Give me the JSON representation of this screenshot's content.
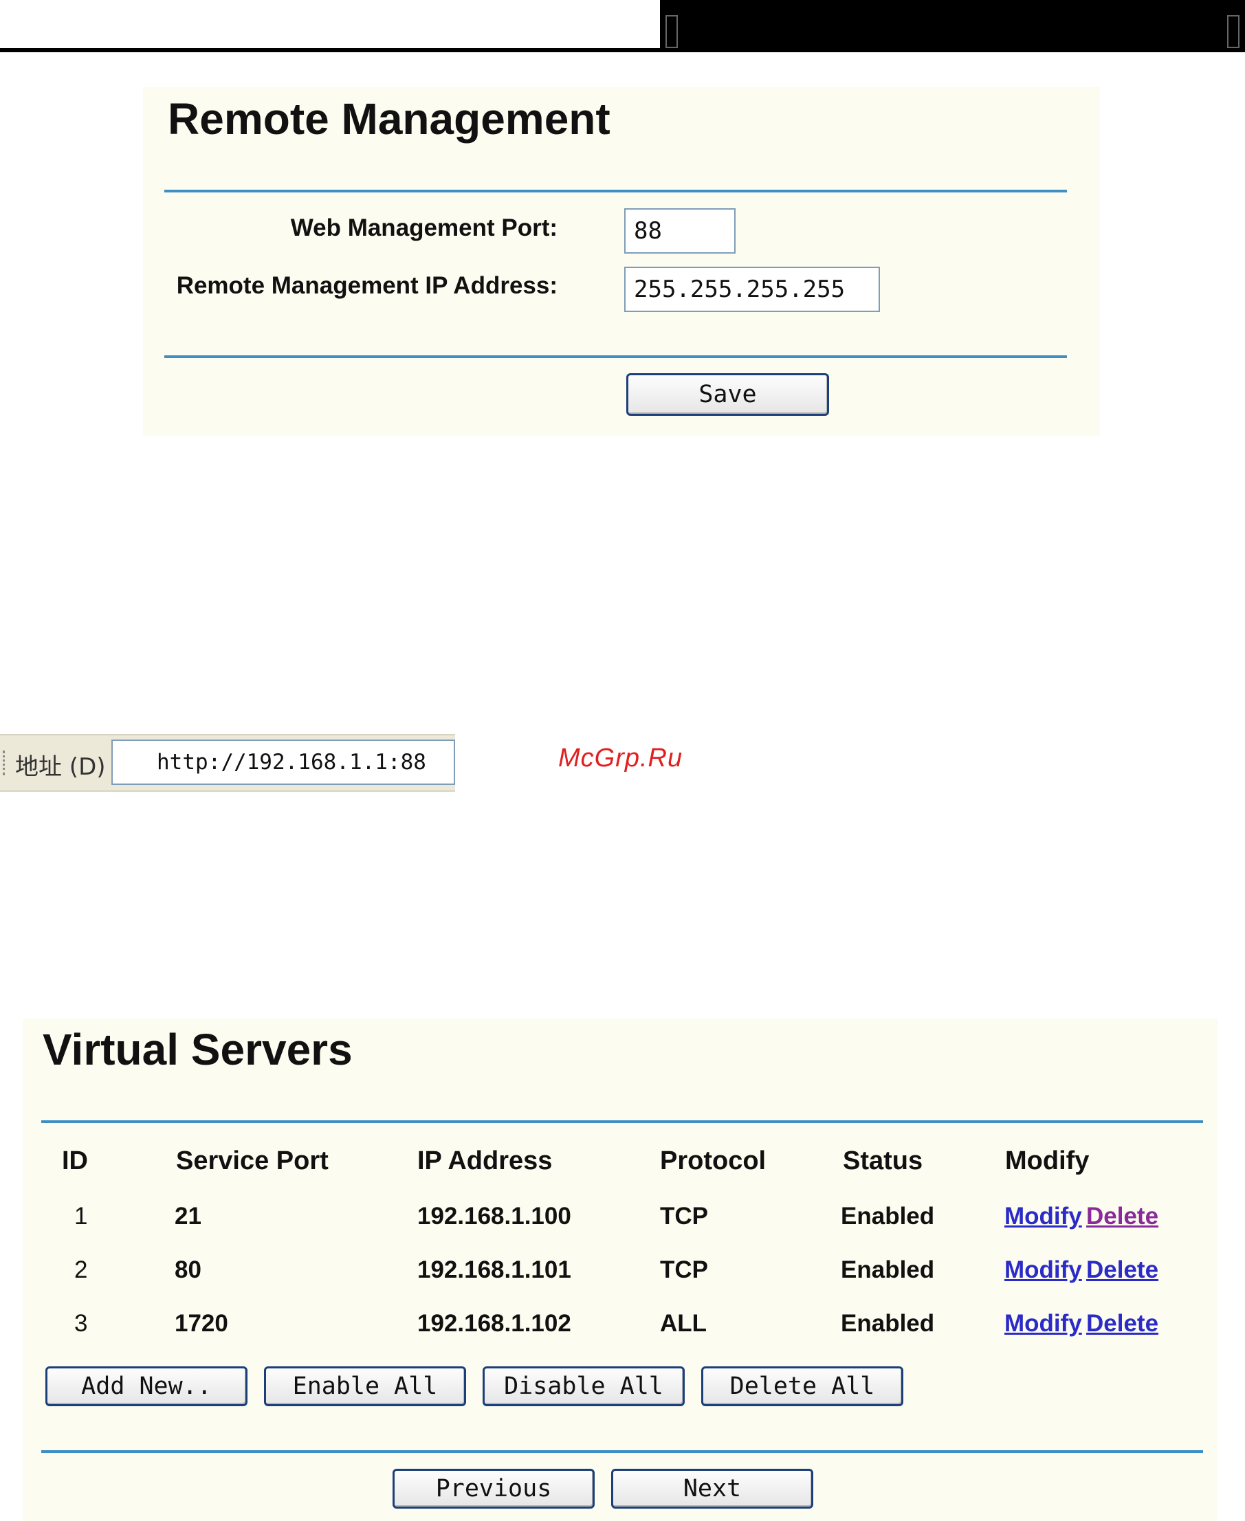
{
  "remote_management": {
    "title": "Remote Management",
    "port_label": "Web Management Port:",
    "port_value": "88",
    "ip_label": "Remote Management IP Address:",
    "ip_value": "255.255.255.255",
    "save_label": "Save"
  },
  "address_bar": {
    "label": "地址 (D)",
    "url": "http://192.168.1.1:88"
  },
  "watermark": "McGrp.Ru",
  "virtual_servers": {
    "title": "Virtual Servers",
    "columns": [
      "ID",
      "Service Port",
      "IP Address",
      "Protocol",
      "Status",
      "Modify"
    ],
    "rows": [
      {
        "id": "1",
        "port": "21",
        "ip": "192.168.1.100",
        "protocol": "TCP",
        "status": "Enabled",
        "modify": "Modify",
        "delete": "Delete"
      },
      {
        "id": "2",
        "port": "80",
        "ip": "192.168.1.101",
        "protocol": "TCP",
        "status": "Enabled",
        "modify": "Modify",
        "delete": "Delete"
      },
      {
        "id": "3",
        "port": "1720",
        "ip": "192.168.1.102",
        "protocol": "ALL",
        "status": "Enabled",
        "modify": "Modify",
        "delete": "Delete"
      }
    ],
    "buttons": {
      "add_new": "Add New..",
      "enable_all": "Enable All",
      "disable_all": "Disable All",
      "delete_all": "Delete All",
      "previous": "Previous",
      "next": "Next"
    }
  }
}
